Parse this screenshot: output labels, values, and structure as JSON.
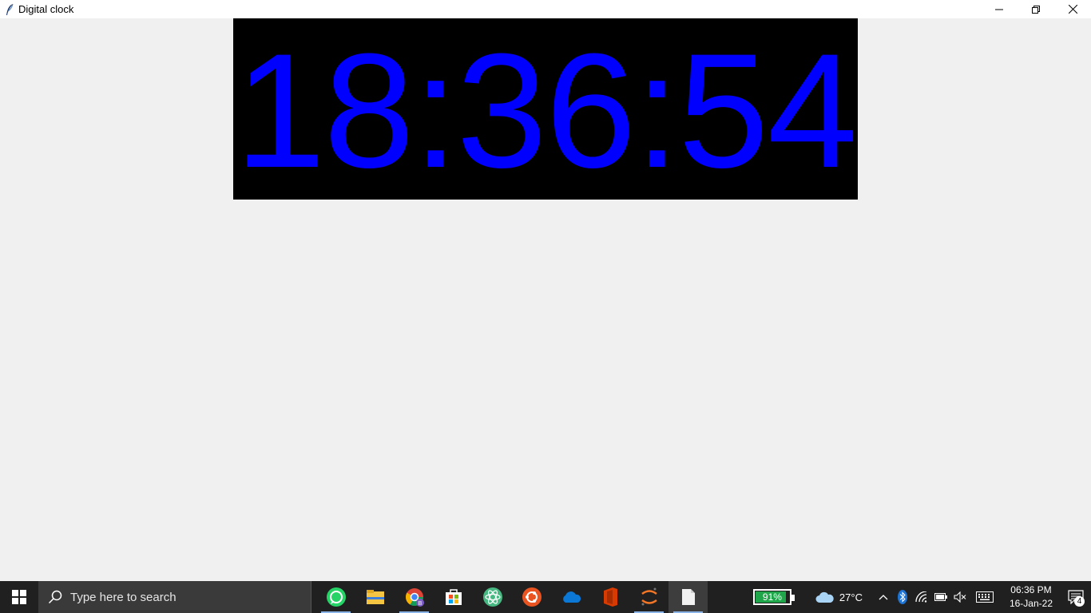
{
  "window": {
    "title": "Digital clock",
    "controls": {
      "minimize": "minimize-icon",
      "restore": "restore-icon",
      "close": "close-icon"
    }
  },
  "clock": {
    "time": "18:36:54",
    "foreground": "#0000ff",
    "background": "#000000"
  },
  "taskbar": {
    "search_placeholder": "Type here to search",
    "apps": [
      {
        "name": "whatsapp-icon",
        "running": true
      },
      {
        "name": "file-explorer-icon",
        "running": false
      },
      {
        "name": "chrome-icon",
        "running": true
      },
      {
        "name": "microsoft-store-icon",
        "running": false
      },
      {
        "name": "atom-icon",
        "running": false
      },
      {
        "name": "ubuntu-icon",
        "running": false
      },
      {
        "name": "onedrive-icon",
        "running": false
      },
      {
        "name": "office-icon",
        "running": false
      },
      {
        "name": "jupyter-icon",
        "running": true
      },
      {
        "name": "notepad-icon",
        "running": true,
        "active": true
      }
    ],
    "battery": {
      "label": "91%",
      "level": 0.91,
      "color": "#1fa64b"
    },
    "weather": {
      "temperature": "27°C"
    },
    "time": "06:36 PM",
    "date": "16-Jan-22",
    "notifications": "4"
  }
}
